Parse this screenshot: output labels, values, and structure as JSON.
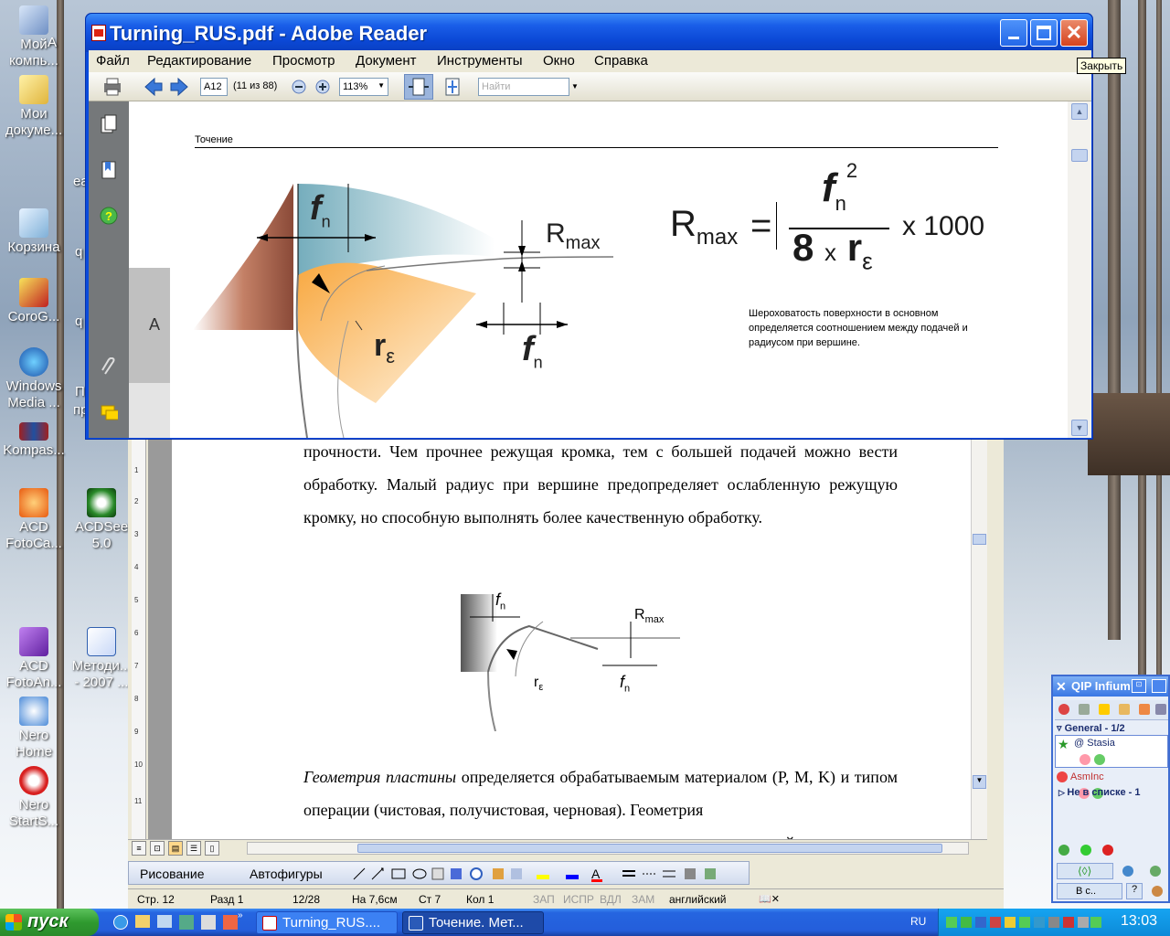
{
  "desktop": {
    "icons": [
      {
        "id": "my-computer",
        "label": "Мой компь..."
      },
      {
        "id": "my-documents",
        "label": "Мои докуме..."
      },
      {
        "id": "recycle-bin",
        "label": "Корзина"
      },
      {
        "id": "corog",
        "label": "CoroG..."
      },
      {
        "id": "wmp",
        "label": "Windows Media ..."
      },
      {
        "id": "kompas",
        "label": "Kompas..."
      },
      {
        "id": "acd-fotocanvas",
        "label": "ACD FotoCa..."
      },
      {
        "id": "acdsee",
        "label": "ACDSee 5.0"
      },
      {
        "id": "acd-fotoangelo",
        "label": "ACD FotoAn..."
      },
      {
        "id": "metodichka",
        "label": "Методи... - 2007 ..."
      },
      {
        "id": "nero-home",
        "label": "Nero Home"
      },
      {
        "id": "nero-startsmart",
        "label": "Nero StartS..."
      }
    ],
    "partial_labels": [
      "А",
      "еа",
      "q",
      "q",
      "П",
      "пр"
    ]
  },
  "reader": {
    "title": "Turning_RUS.pdf - Adobe Reader",
    "menu": [
      "Файл",
      "Редактирование",
      "Просмотр",
      "Документ",
      "Инструменты",
      "Окно",
      "Справка"
    ],
    "page_label": "A12",
    "page_count": "(11 из 88)",
    "zoom": "113%",
    "search_placeholder": "Найти",
    "tooltip": "Закрыть",
    "doc": {
      "section_header": "Точение",
      "side_tab": "A",
      "label_fn": "f",
      "label_fn_sub": "n",
      "label_rmax": "R",
      "label_rmax_sub": "max",
      "label_re": "r",
      "label_re_sub": "ε",
      "formula_lhs": "R",
      "formula_lhs_sub": "max",
      "formula_eq": "=",
      "formula_num": "f",
      "formula_num_sub": "n",
      "formula_num_sup": "2",
      "formula_den_8": "8",
      "formula_den_x": "x",
      "formula_den_r": "r",
      "formula_den_sub": "ε",
      "formula_mult": "x 1000",
      "note": "Шероховатость поверхности в основном определяется соотношением между подачей и радиусом при вершине."
    }
  },
  "word": {
    "para1": "прочности. Чем прочнее режущая кромка, тем с большей подачей можно вести обработку. Малый радиус при вершине предопределяет ослабленную режущую кромку, но способную выполнять более качественную обработку.",
    "para2_italic": "Геометрия пластины",
    "para2_rest": " определяется обрабатываемым материалом (P, M, K) и типом операции (чистовая, получистовая, черновая). Геометрия",
    "para3_partial": "пластины определяет характер процесса резания, прочность режущей",
    "ruler_numbers": [
      "1",
      "2",
      "3",
      "4",
      "5",
      "6",
      "7",
      "8",
      "9",
      "10",
      "11"
    ],
    "drawing_label": "Рисование",
    "autoshapes_label": "Автофигуры",
    "status": {
      "page": "Стр. 12",
      "section": "Разд 1",
      "pages": "12/28",
      "at": "На 7,6см",
      "line": "Ст 7",
      "col": "Кол 1",
      "rec": "ЗАП",
      "trk": "ИСПР",
      "ext": "ВДЛ",
      "ovr": "ЗАМ",
      "lang": "английский"
    }
  },
  "qip": {
    "title": "QIP Infium",
    "group": "General - 1/2",
    "contact1": "Stasia",
    "contact2": "AsmInc",
    "not_in_list": "Не в списке - 1",
    "status_btn": "В с..",
    "help_btn": "?"
  },
  "taskbar": {
    "start": "пуск",
    "tasks": [
      "Turning_RUS....",
      "Точение. Мет..."
    ],
    "lang": "RU",
    "clock": "13:03"
  }
}
